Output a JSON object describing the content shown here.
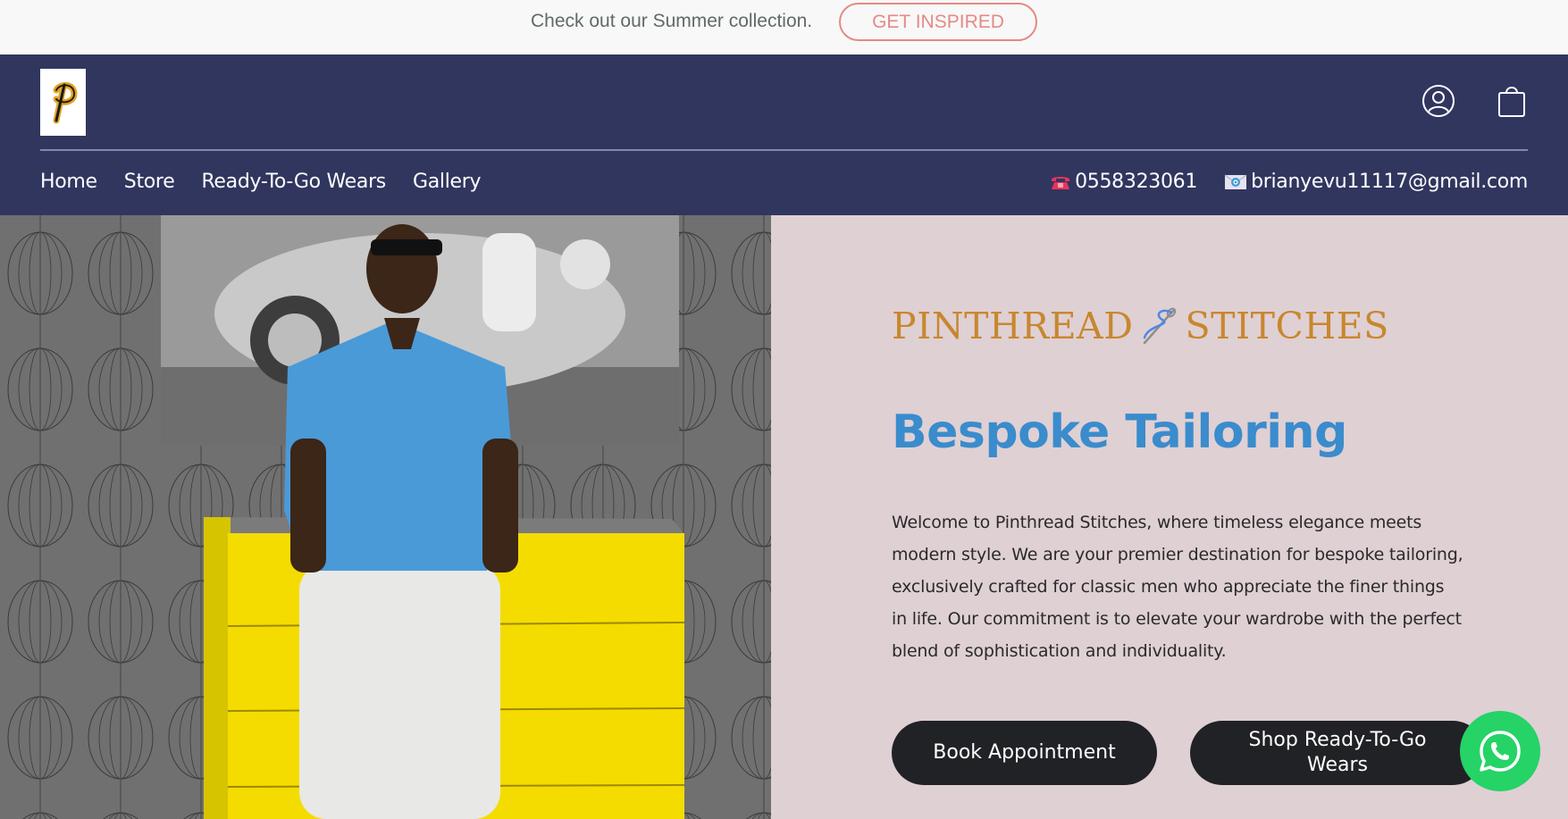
{
  "announcement": {
    "text": "Check out our Summer collection.",
    "button_label": "GET INSPIRED"
  },
  "header": {
    "logo_letter": "P",
    "icons": {
      "account": "user-circle-icon",
      "cart": "shopping-bag-icon"
    },
    "nav": [
      {
        "label": "Home"
      },
      {
        "label": "Store"
      },
      {
        "label": "Ready-To-Go Wears"
      },
      {
        "label": "Gallery"
      }
    ],
    "contact": {
      "phone_icon": "☎",
      "phone": "0558323061",
      "email_icon": "✉",
      "email": "brianyevu11117@gmail.com"
    }
  },
  "hero": {
    "image_alt": "Man in blue shirt and white trousers leaning on yellow cabinet",
    "brand_left": "PINTHREAD",
    "brand_right": "STITCHES",
    "headline": "Bespoke Tailoring",
    "paragraph": "Welcome to Pinthread Stitches, where timeless elegance meets modern style. We are your premier destination for bespoke tailoring, exclusively crafted for classic men who appreciate the finer things in life. Our commitment is to elevate your wardrobe with the perfect blend of sophistication and individuality.",
    "buttons": {
      "book": "Book Appointment",
      "shop": "Shop Ready-To-Go Wears"
    }
  },
  "colors": {
    "header_bg": "#31365f",
    "panel_bg": "#dfd0d4",
    "brand_gold": "#c8872e",
    "headline_blue": "#3a8ccc",
    "announcement_accent": "#e58a85",
    "button_dark": "#212226",
    "whatsapp_green": "#25d366"
  }
}
